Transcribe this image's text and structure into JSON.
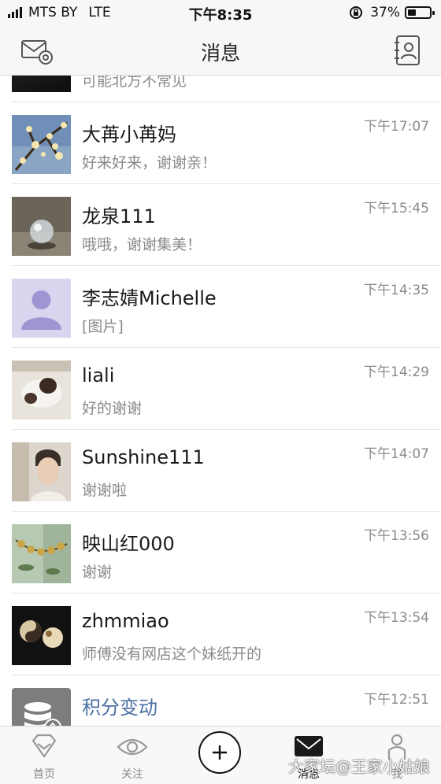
{
  "status_bar": {
    "carrier": "MTS BY",
    "network": "LTE",
    "time": "下午8:35",
    "battery_text": "37%",
    "battery_level": 0.37
  },
  "nav": {
    "title": "消息",
    "left_icon": "mail-settings-icon",
    "right_icon": "contacts-book-icon"
  },
  "partial_row": {
    "message": "可能北方不常见"
  },
  "conversations": [
    {
      "name": "大苒小苒妈",
      "message": "好来好来，谢谢亲！",
      "time": "下午17:07",
      "avatar": "plum-blossom-photo"
    },
    {
      "name": "龙泉111",
      "message": "哦哦，谢谢集美！",
      "time": "下午15:45",
      "avatar": "crystal-ball-photo"
    },
    {
      "name": "李志婧Michelle",
      "message": "[图片]",
      "time": "下午14:35",
      "avatar": "default-person-avatar"
    },
    {
      "name": "liali",
      "message": "好的谢谢",
      "time": "下午14:29",
      "avatar": "cat-photo"
    },
    {
      "name": "Sunshine111",
      "message": "谢谢啦",
      "time": "下午14:07",
      "avatar": "young-man-photo"
    },
    {
      "name": "映山红000",
      "message": "谢谢",
      "time": "下午13:56",
      "avatar": "jade-beads-photo"
    },
    {
      "name": "zhmmiao",
      "message": "师傅没有网店这个妹纸开的",
      "time": "下午13:54",
      "avatar": "beads-dark-photo"
    },
    {
      "name": "积分变动",
      "message": "",
      "time": "下午12:51",
      "avatar": "database-icon",
      "system": true
    }
  ],
  "tabs": [
    {
      "label": "首页",
      "icon": "diamond-home-icon",
      "active": false
    },
    {
      "label": "关注",
      "icon": "eye-icon",
      "active": false
    },
    {
      "label": "",
      "icon": "plus-icon",
      "active": false
    },
    {
      "label": "消息",
      "icon": "mail-icon",
      "active": true
    },
    {
      "label": "我",
      "icon": "person-icon",
      "active": false
    }
  ],
  "watermark": "大家坛@王家小姑娘",
  "colors": {
    "system_name": "#4a6fa5",
    "secondary_text": "#8a8a8a",
    "bar_bg": "#f7f7f7",
    "default_avatar_bg": "#d8d5ee",
    "default_avatar_fg": "#9d96d2"
  }
}
